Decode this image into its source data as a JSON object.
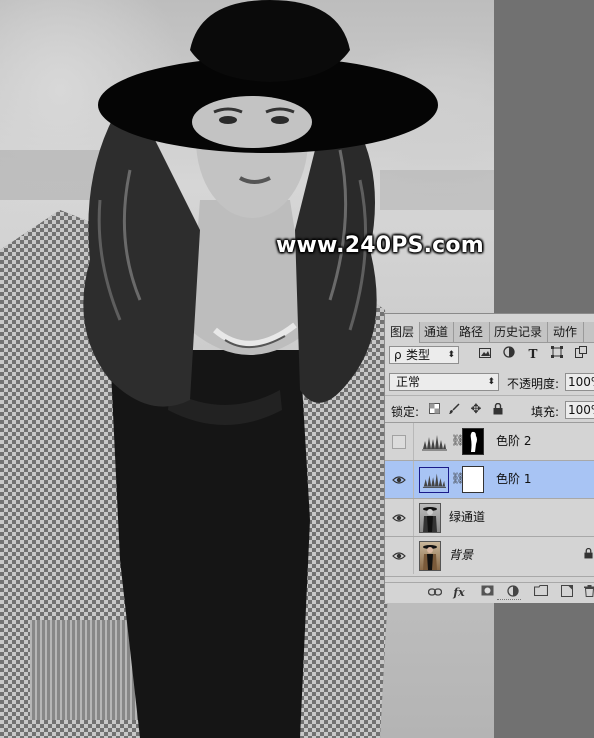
{
  "watermark": {
    "text": "www.240PS.com"
  },
  "layers_panel": {
    "tabs": [
      {
        "label": "图层",
        "active": true
      },
      {
        "label": "通道",
        "active": false
      },
      {
        "label": "路径",
        "active": false
      },
      {
        "label": "历史记录",
        "active": false
      },
      {
        "label": "动作",
        "active": false
      }
    ],
    "filter": {
      "search_symbol": "ρ",
      "kind_label": "类型",
      "dropdown_arrow": "⬍"
    },
    "filter_icons": [
      "image-icon",
      "adjustment-icon",
      "type-icon",
      "shape-icon",
      "smart-object-icon"
    ],
    "blend_mode": "正常",
    "opacity_label": "不透明度:",
    "opacity_value": "100%",
    "lock_label": "锁定:",
    "fill_label": "填充:",
    "fill_value": "100%",
    "layers": [
      {
        "name": "色阶 2",
        "visible": false,
        "selected": false,
        "kind": "adjustment-levels"
      },
      {
        "name": "色阶 1",
        "visible": true,
        "selected": true,
        "kind": "adjustment-levels"
      },
      {
        "name": "绿通道",
        "visible": true,
        "selected": false,
        "kind": "pixel"
      },
      {
        "name": "背景",
        "visible": true,
        "selected": false,
        "kind": "background",
        "locked": true
      }
    ],
    "bottom_icons": [
      "link-icon",
      "fx-icon",
      "add-mask-icon",
      "new-adjustment-icon",
      "new-group-icon",
      "new-layer-icon",
      "delete-icon"
    ],
    "fx_label": "fx"
  },
  "colors": {
    "selection": "#a8c4f4",
    "panel_bg": "#d4d4d4"
  }
}
